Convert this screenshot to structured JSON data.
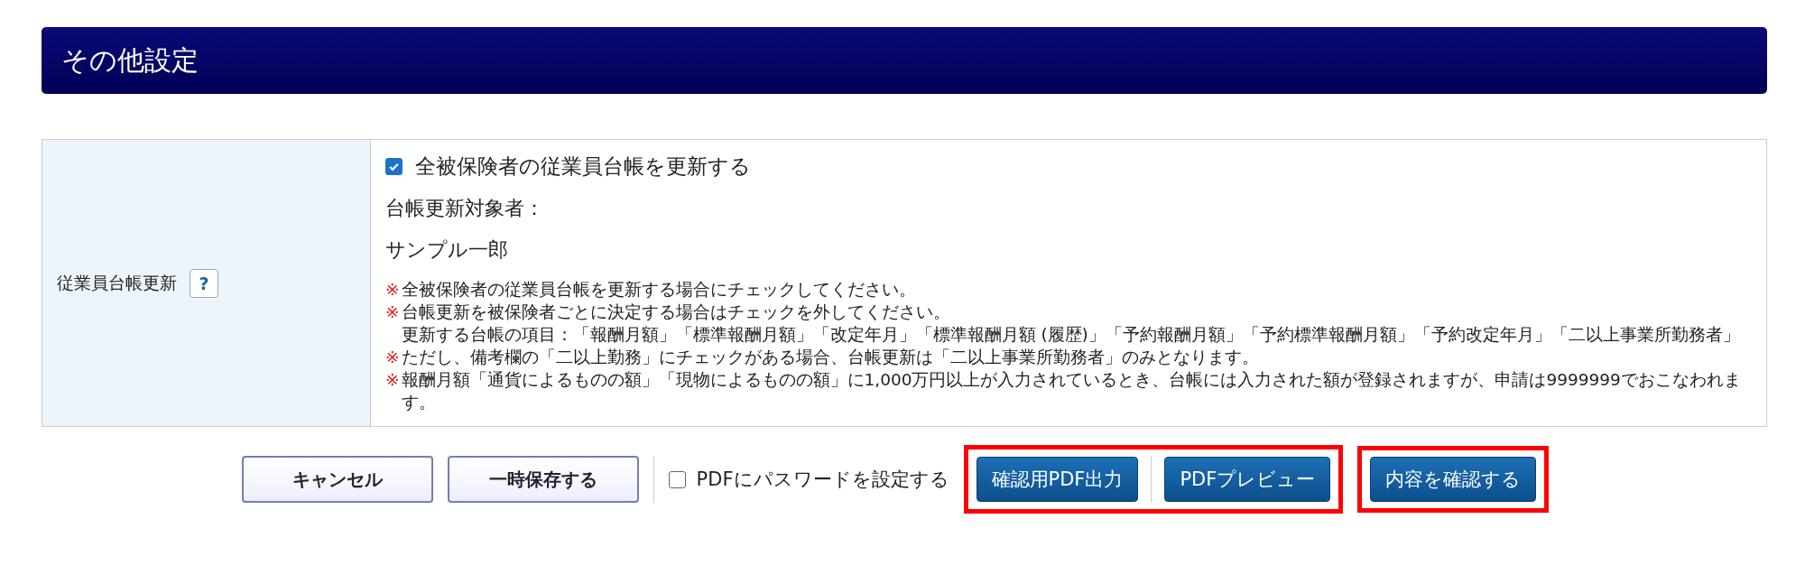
{
  "section": {
    "title": "その他設定"
  },
  "setting": {
    "label": "従業員台帳更新",
    "help": "?",
    "checkbox": {
      "label": "全被保険者の従業員台帳を更新する",
      "checked": true
    },
    "target_label": "台帳更新対象者：",
    "target_name": "サンプル一郎",
    "notes": [
      {
        "mark": "※",
        "text": "全被保険者の従業員台帳を更新する場合にチェックしてください。"
      },
      {
        "mark": "※",
        "text": "台帳更新を被保険者ごとに決定する場合はチェックを外してください。",
        "detail": "更新する台帳の項目：「報酬月額」「標準報酬月額」「改定年月」「標準報酬月額 (履歴)」「予約報酬月額」「予約標準報酬月額」「予約改定年月」「二以上事業所勤務者」"
      },
      {
        "mark": "※",
        "text": "ただし、備考欄の「二以上勤務」にチェックがある場合、台帳更新は「二以上事業所勤務者」のみとなります。"
      },
      {
        "mark": "※",
        "text": "報酬月額「通貨によるものの額」「現物によるものの額」に1,000万円以上が入力されているとき、台帳には入力された額が登録されますが、申請は9999999でおこなわれます。"
      }
    ]
  },
  "actions": {
    "plain_buttons": [
      "キャンセル",
      "一時保存する"
    ],
    "pdf_password": {
      "label": "PDFにパスワードを設定する",
      "checked": false
    },
    "groups": [
      {
        "highlighted": true,
        "buttons": [
          "確認用PDF出力",
          "PDFプレビュー"
        ]
      },
      {
        "highlighted": true,
        "buttons": [
          "内容を確認する"
        ]
      }
    ]
  }
}
